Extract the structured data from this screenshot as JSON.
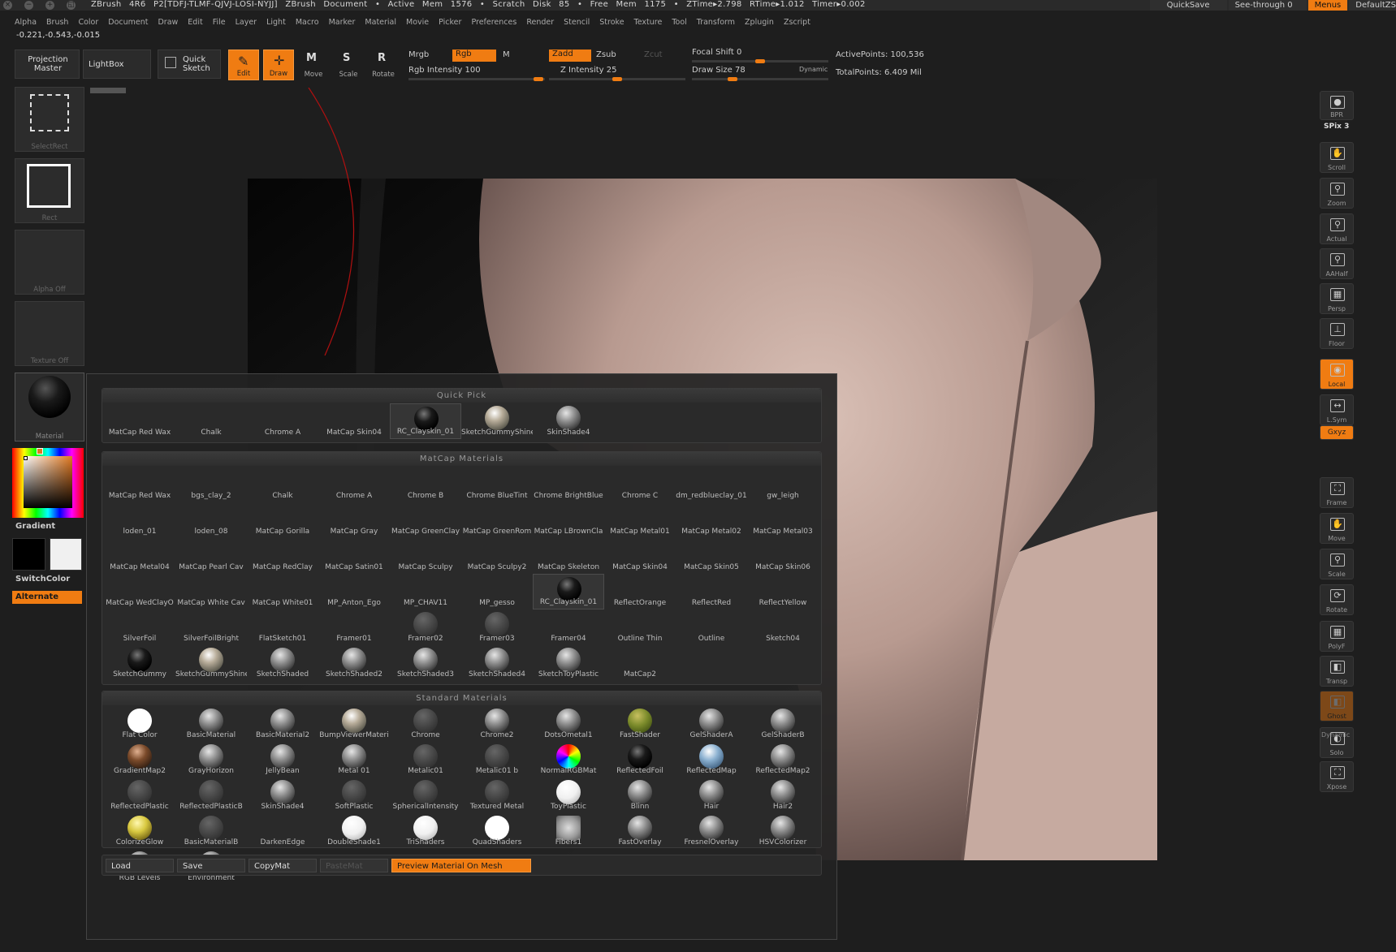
{
  "titlebar": {
    "title": "ZBrush 4R6 P2[TDFJ-TLMF-QJVJ-LOSI-NYJJ]   ZBrush Document   • Active Mem 1576 • Scratch Disk 85 • Free Mem 1175 • ZTime▸2.798 RTime▸1.012 Timer▸0.002",
    "quicksave": "QuickSave",
    "seethrough": "See-through  0",
    "menus": "Menus",
    "defaultzscript": "DefaultZS"
  },
  "menubar": [
    "Alpha",
    "Brush",
    "Color",
    "Document",
    "Draw",
    "Edit",
    "File",
    "Layer",
    "Light",
    "Macro",
    "Marker",
    "Material",
    "Movie",
    "Picker",
    "Preferences",
    "Render",
    "Stencil",
    "Stroke",
    "Texture",
    "Tool",
    "Transform",
    "Zplugin",
    "Zscript"
  ],
  "coords": "-0.221,-0.543,-0.015",
  "toolbar": {
    "projection_master": "Projection Master",
    "lightbox": "LightBox",
    "quick_sketch": "Quick Sketch",
    "edit": "Edit",
    "draw": "Draw",
    "move": "Move",
    "scale": "Scale",
    "rotate": "Rotate",
    "mrgb": "Mrgb",
    "rgb": "Rgb",
    "m": "M",
    "zadd": "Zadd",
    "zsub": "Zsub",
    "zcut": "Zcut",
    "rgb_intensity": "Rgb Intensity 100",
    "z_intensity": "Z Intensity 25",
    "focal_shift": "Focal Shift 0",
    "draw_size": "Draw Size 78",
    "dynamic": "Dynamic",
    "active_points": "ActivePoints: 100,536",
    "total_points": "TotalPoints: 6.409 Mil",
    "accent_color": "#f07c12"
  },
  "leftpanel": {
    "selectrect": "SelectRect",
    "rect": "Rect",
    "alpha_off": "Alpha Off",
    "texture_off": "Texture Off",
    "material": "Material",
    "gradient": "Gradient",
    "switchcolor": "SwitchColor",
    "alternate": "Alternate"
  },
  "rightshelf": [
    {
      "name": "bpr",
      "label": "BPR"
    },
    {
      "name": "scroll",
      "label": "Scroll"
    },
    {
      "name": "zoom",
      "label": "Zoom"
    },
    {
      "name": "actual",
      "label": "Actual"
    },
    {
      "name": "aahalf",
      "label": "AAHalf"
    },
    {
      "name": "persp",
      "label": "Persp"
    },
    {
      "name": "floor",
      "label": "Floor"
    },
    {
      "name": "local",
      "label": "Local"
    },
    {
      "name": "lsym",
      "label": "L.Sym"
    },
    {
      "name": "xyz",
      "label": "Gxyz"
    },
    {
      "name": "frame",
      "label": "Frame"
    },
    {
      "name": "move",
      "label": "Move"
    },
    {
      "name": "scale",
      "label": "Scale"
    },
    {
      "name": "rotate",
      "label": "Rotate"
    },
    {
      "name": "polyf",
      "label": "PolyF"
    },
    {
      "name": "transp",
      "label": "Transp"
    },
    {
      "name": "ghost",
      "label": "Ghost"
    },
    {
      "name": "solo",
      "label": "Solo"
    },
    {
      "name": "xpose",
      "label": "Xpose"
    }
  ],
  "spix": "SPix 3",
  "dynamic_label": "Dynamic",
  "popup": {
    "quick_pick_title": "Quick Pick",
    "quick_pick": [
      {
        "n": "MatCap Red Wax",
        "s": ""
      },
      {
        "n": "Chalk",
        "s": ""
      },
      {
        "n": "Chrome A",
        "s": ""
      },
      {
        "n": "MatCap Skin04",
        "s": ""
      },
      {
        "n": "RC_Clayskin_01",
        "s": "dark",
        "sel": true
      },
      {
        "n": "SketchGummyShine",
        "s": "warm"
      },
      {
        "n": "SkinShade4",
        "s": "gray"
      }
    ],
    "matcap_title": "MatCap Materials",
    "matcap": [
      {
        "n": "MatCap Red Wax",
        "s": ""
      },
      {
        "n": "bgs_clay_2",
        "s": ""
      },
      {
        "n": "Chalk",
        "s": ""
      },
      {
        "n": "Chrome A",
        "s": ""
      },
      {
        "n": "Chrome B",
        "s": ""
      },
      {
        "n": "Chrome BlueTint",
        "s": ""
      },
      {
        "n": "Chrome BrightBlue",
        "s": ""
      },
      {
        "n": "Chrome C",
        "s": ""
      },
      {
        "n": "dm_redblueclay_01",
        "s": ""
      },
      {
        "n": "gw_leigh",
        "s": ""
      },
      {
        "n": "loden_01",
        "s": ""
      },
      {
        "n": "loden_08",
        "s": ""
      },
      {
        "n": "MatCap Gorilla",
        "s": ""
      },
      {
        "n": "MatCap Gray",
        "s": ""
      },
      {
        "n": "MatCap GreenClay",
        "s": ""
      },
      {
        "n": "MatCap GreenRom",
        "s": ""
      },
      {
        "n": "MatCap LBrownCla",
        "s": ""
      },
      {
        "n": "MatCap Metal01",
        "s": ""
      },
      {
        "n": "MatCap Metal02",
        "s": ""
      },
      {
        "n": "MatCap Metal03",
        "s": ""
      },
      {
        "n": "MatCap Metal04",
        "s": ""
      },
      {
        "n": "MatCap Pearl Cav",
        "s": ""
      },
      {
        "n": "MatCap RedClay",
        "s": ""
      },
      {
        "n": "MatCap Satin01",
        "s": ""
      },
      {
        "n": "MatCap Sculpy",
        "s": ""
      },
      {
        "n": "MatCap Sculpy2",
        "s": ""
      },
      {
        "n": "MatCap Skeleton",
        "s": ""
      },
      {
        "n": "MatCap Skin04",
        "s": ""
      },
      {
        "n": "MatCap Skin05",
        "s": ""
      },
      {
        "n": "MatCap Skin06",
        "s": ""
      },
      {
        "n": "MatCap WedClayO",
        "s": ""
      },
      {
        "n": "MatCap White Cav",
        "s": ""
      },
      {
        "n": "MatCap White01",
        "s": ""
      },
      {
        "n": "MP_Anton_Ego",
        "s": ""
      },
      {
        "n": "MP_CHAV11",
        "s": ""
      },
      {
        "n": "MP_gesso",
        "s": ""
      },
      {
        "n": "RC_Clayskin_01",
        "s": "dark",
        "sel": true
      },
      {
        "n": "ReflectOrange",
        "s": ""
      },
      {
        "n": "ReflectRed",
        "s": ""
      },
      {
        "n": "ReflectYellow",
        "s": ""
      },
      {
        "n": "SilverFoil",
        "s": ""
      },
      {
        "n": "SilverFoilBright",
        "s": ""
      },
      {
        "n": "FlatSketch01",
        "s": ""
      },
      {
        "n": "Framer01",
        "s": ""
      },
      {
        "n": "Framer02",
        "s": "dim"
      },
      {
        "n": "Framer03",
        "s": "dim"
      },
      {
        "n": "Framer04",
        "s": ""
      },
      {
        "n": "Outline Thin",
        "s": ""
      },
      {
        "n": "Outline",
        "s": ""
      },
      {
        "n": "Sketch04",
        "s": ""
      },
      {
        "n": "SketchGummy",
        "s": "dark"
      },
      {
        "n": "SketchGummyShine",
        "s": "warm"
      },
      {
        "n": "SketchShaded",
        "s": "gray"
      },
      {
        "n": "SketchShaded2",
        "s": "gray"
      },
      {
        "n": "SketchShaded3",
        "s": "gray"
      },
      {
        "n": "SketchShaded4",
        "s": "gray"
      },
      {
        "n": "SketchToyPlastic",
        "s": "gray"
      },
      {
        "n": "MatCap2",
        "s": ""
      }
    ],
    "standard_title": "Standard Materials",
    "standard": [
      {
        "n": "Flat Color",
        "s": "flat"
      },
      {
        "n": "BasicMaterial",
        "s": "gray"
      },
      {
        "n": "BasicMaterial2",
        "s": "gray"
      },
      {
        "n": "BumpViewerMateri",
        "s": "warm"
      },
      {
        "n": "Chrome",
        "s": "dim"
      },
      {
        "n": "Chrome2",
        "s": "gray"
      },
      {
        "n": "DotsOmetal1",
        "s": "gray"
      },
      {
        "n": "FastShader",
        "s": "green"
      },
      {
        "n": "GelShaderA",
        "s": "gray"
      },
      {
        "n": "GelShaderB",
        "s": "gray"
      },
      {
        "n": "GradientMap2",
        "s": "brown"
      },
      {
        "n": "GrayHorizon",
        "s": "gray"
      },
      {
        "n": "JellyBean",
        "s": "gray"
      },
      {
        "n": "Metal 01",
        "s": "gray"
      },
      {
        "n": "Metalic01",
        "s": "dim"
      },
      {
        "n": "Metalic01 b",
        "s": "dim"
      },
      {
        "n": "NormalRGBMat",
        "s": "rgb"
      },
      {
        "n": "ReflectedFoil",
        "s": "dark"
      },
      {
        "n": "ReflectedMap",
        "s": "blue"
      },
      {
        "n": "ReflectedMap2",
        "s": "gray"
      },
      {
        "n": "ReflectedPlastic",
        "s": "dim"
      },
      {
        "n": "ReflectedPlasticB",
        "s": "dim"
      },
      {
        "n": "SkinShade4",
        "s": "gray"
      },
      {
        "n": "SoftPlastic",
        "s": "dim"
      },
      {
        "n": "SphericalIntensity",
        "s": "dim"
      },
      {
        "n": "Textured Metal",
        "s": "dim"
      },
      {
        "n": "ToyPlastic",
        "s": "white"
      },
      {
        "n": "Blinn",
        "s": "gray"
      },
      {
        "n": "Hair",
        "s": "gray"
      },
      {
        "n": "Hair2",
        "s": "gray"
      },
      {
        "n": "ColorizeGlow",
        "s": "yellow"
      },
      {
        "n": "BasicMaterialB",
        "s": "dim"
      },
      {
        "n": "DarkenEdge",
        "s": ""
      },
      {
        "n": "DoubleShade1",
        "s": "white"
      },
      {
        "n": "TriShaders",
        "s": "white"
      },
      {
        "n": "QuadShaders",
        "s": "flat"
      },
      {
        "n": "Fibers1",
        "s": "fur"
      },
      {
        "n": "FastOverlay",
        "s": "gray"
      },
      {
        "n": "FresnelOverlay",
        "s": "gray"
      },
      {
        "n": "HSVColorizer",
        "s": "gray"
      },
      {
        "n": "RGB Levels",
        "s": "gray"
      },
      {
        "n": "Environment",
        "s": "gray"
      }
    ],
    "buttons": {
      "load": "Load",
      "save": "Save",
      "copymat": "CopyMat",
      "pastemat": "PasteMat",
      "preview": "Preview Material On Mesh"
    }
  }
}
